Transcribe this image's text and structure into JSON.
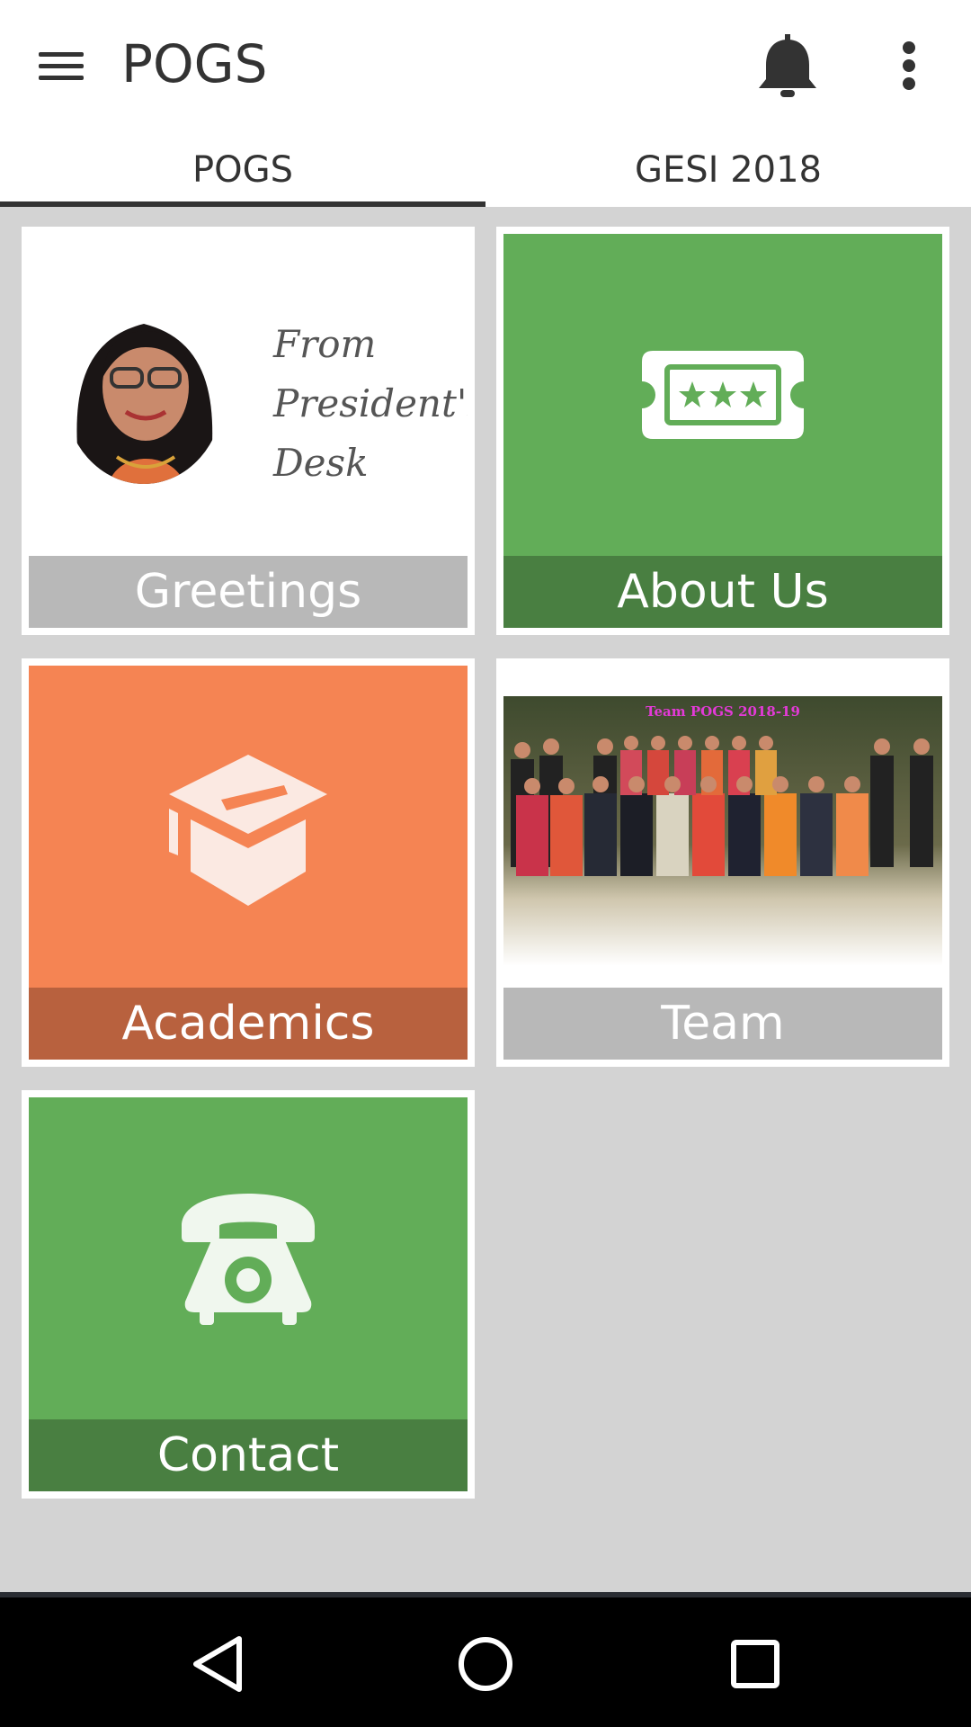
{
  "appbar": {
    "title": "POGS",
    "icons": [
      "menu-icon",
      "bell-icon",
      "more-vert-icon"
    ]
  },
  "tabs": [
    {
      "label": "POGS",
      "active": true
    },
    {
      "label": "GESI 2018",
      "active": false
    }
  ],
  "tiles": {
    "greetings": {
      "label": "Greetings",
      "quote_line1": "From",
      "quote_line2": "President's",
      "quote_line3": "Desk"
    },
    "about": {
      "label": "About Us",
      "icon": "ticket-stars-icon"
    },
    "academics": {
      "label": "Academics",
      "icon": "graduation-cap-icon"
    },
    "team": {
      "label": "Team",
      "photo_caption": "Team POGS 2018-19"
    },
    "contact": {
      "label": "Contact",
      "icon": "telephone-icon"
    }
  },
  "colors": {
    "green": "#62ad58",
    "green_dark": "#497f41",
    "orange": "#f58453",
    "orange_dark": "#b8613e",
    "grey_label": "#b8b8b8",
    "background": "#d3d3d3"
  },
  "navbar": {
    "icons": [
      "back-icon",
      "home-icon",
      "recents-icon"
    ]
  }
}
